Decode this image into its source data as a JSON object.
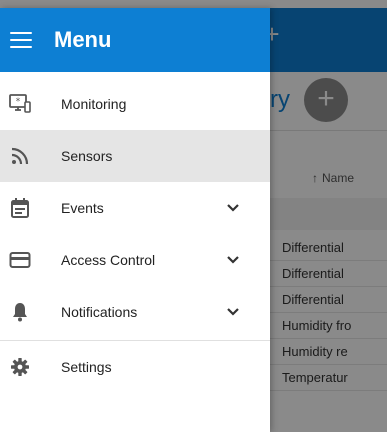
{
  "drawer": {
    "title": "Menu",
    "items": [
      {
        "label": "Monitoring",
        "icon": "monitoring-icon",
        "active": false,
        "expandable": false
      },
      {
        "label": "Sensors",
        "icon": "rss-feed-icon",
        "active": true,
        "expandable": false
      },
      {
        "label": "Events",
        "icon": "calendar-icon",
        "active": false,
        "expandable": true
      },
      {
        "label": "Access Control",
        "icon": "credit-card-icon",
        "active": false,
        "expandable": true
      },
      {
        "label": "Notifications",
        "icon": "bell-icon",
        "active": false,
        "expandable": true
      },
      {
        "label": "Settings",
        "icon": "gear-icon",
        "active": false,
        "expandable": false
      }
    ]
  },
  "background": {
    "heading_fragment": "ry",
    "plus_symbol": "+",
    "sort_arrow": "↑",
    "column_header": "Name",
    "rows": [
      "Differential",
      "Differential",
      "Differential",
      "Humidity fro",
      "Humidity re",
      "Temperatur"
    ]
  },
  "colors": {
    "accent": "#0d7fd3",
    "drawer_bg": "#ffffff",
    "active_item_bg": "#e5e5e5",
    "icon": "#555555"
  }
}
